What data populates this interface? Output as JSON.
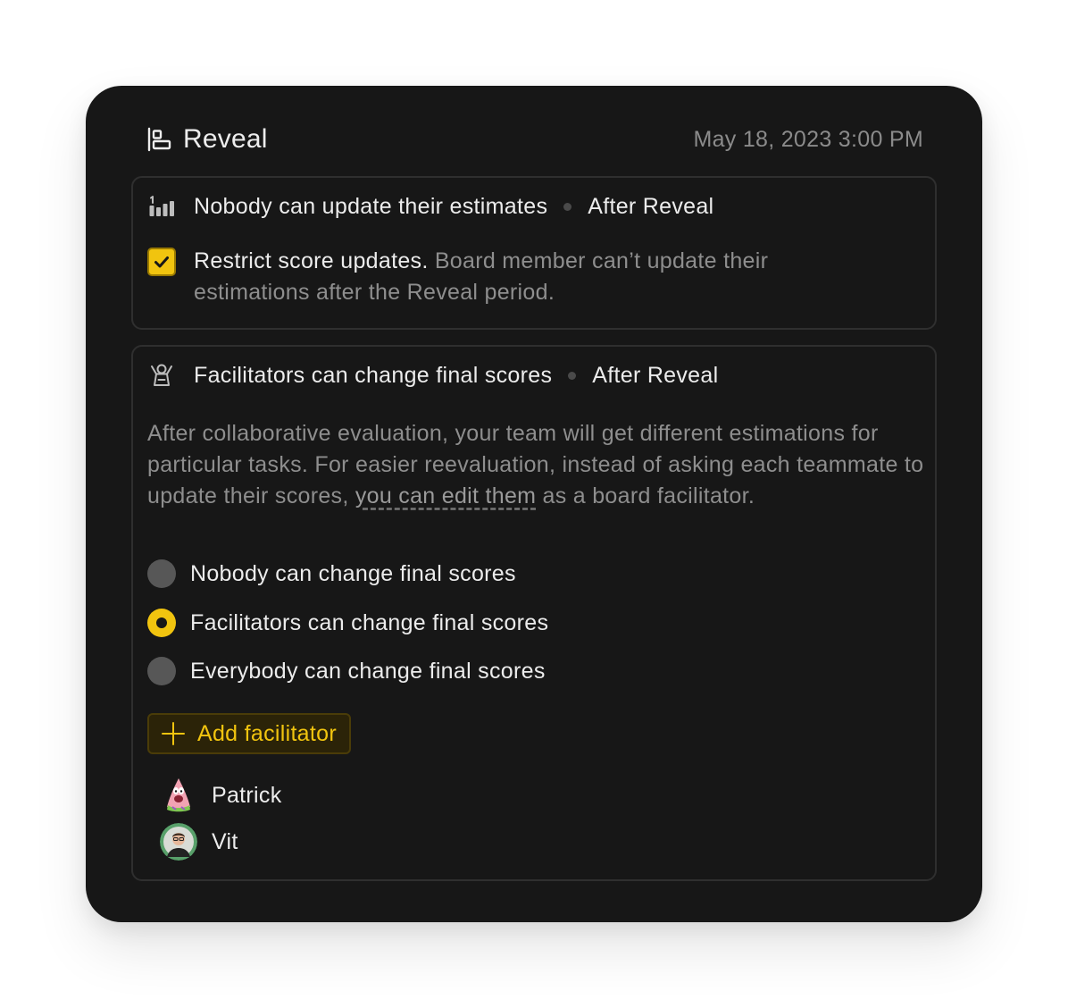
{
  "header": {
    "title": "Reveal",
    "datetime": "May 18, 2023 3:00 PM",
    "icon": "align-left-bars-icon"
  },
  "estimates_section": {
    "icon": "bar-chart-icon",
    "title": "Nobody can update their estimates",
    "tag": "After Reveal",
    "option": {
      "checked": true,
      "label": "Restrict score updates.",
      "description": "Board member can’t update their estimations after the Reveal period."
    }
  },
  "scores_section": {
    "icon": "facilitator-person-icon",
    "title": "Facilitators can change final scores",
    "tag": "After Reveal",
    "description_before_link": "After collaborative evaluation, your team will get different estimations for particular tasks. For easier reevaluation, instead of asking each teammate to update their scores, ",
    "description_link": "you can edit them",
    "description_after_link": " as a board facilitator.",
    "radio_options": [
      {
        "label": "Nobody can change final scores",
        "selected": false
      },
      {
        "label": "Facilitators can change final scores",
        "selected": true
      },
      {
        "label": "Everybody can change final scores",
        "selected": false
      }
    ],
    "add_button_label": "Add facilitator",
    "facilitators": [
      {
        "name": "Patrick",
        "avatar": "patrick-avatar"
      },
      {
        "name": "Vit",
        "avatar": "vit-avatar"
      }
    ]
  },
  "colors": {
    "accent": "#f1c40f",
    "card_background": "#171717",
    "muted_text": "#8e8e8e"
  }
}
